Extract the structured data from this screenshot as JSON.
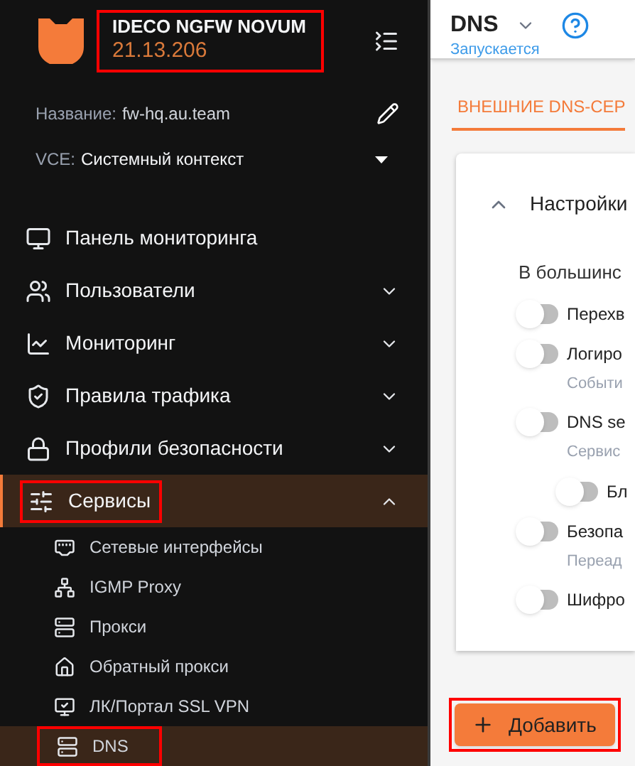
{
  "sidebar": {
    "product": "IDECO NGFW NOVUM",
    "version": "21.13.206",
    "header_highlighted": true,
    "name_label": "Название:",
    "name_value": "fw-hq.au.team",
    "vce_label": "VCE:",
    "vce_value": "Системный контекст",
    "items": [
      {
        "label": "Панель мониторинга",
        "selected": false,
        "highlighted": false
      },
      {
        "label": "Пользователи",
        "expanded": false,
        "selected": false,
        "highlighted": false
      },
      {
        "label": "Мониторинг",
        "expanded": false,
        "selected": false,
        "highlighted": false
      },
      {
        "label": "Правила трафика",
        "expanded": false,
        "selected": false,
        "highlighted": false
      },
      {
        "label": "Профили безопасности",
        "expanded": false,
        "selected": false,
        "highlighted": false
      },
      {
        "label": "Сервисы",
        "expanded": true,
        "selected": true,
        "highlighted": true,
        "children": [
          {
            "label": "Сетевые интерфейсы",
            "selected": false,
            "highlighted": false
          },
          {
            "label": "IGMP Proxy",
            "selected": false,
            "highlighted": false
          },
          {
            "label": "Прокси",
            "selected": false,
            "highlighted": false
          },
          {
            "label": "Обратный прокси",
            "selected": false,
            "highlighted": false
          },
          {
            "label": "ЛК/Портал SSL VPN",
            "selected": false,
            "highlighted": false
          },
          {
            "label": "DNS",
            "selected": true,
            "highlighted": true
          }
        ]
      }
    ]
  },
  "header": {
    "title": "DNS",
    "status": "Запускается"
  },
  "tabs": [
    {
      "label": "ВНЕШНИЕ DNS-СЕР",
      "selected": true
    }
  ],
  "settings": {
    "title": "Настройки",
    "expanded": true,
    "intro": "В большинс",
    "options": [
      {
        "label": "Перехв",
        "on": false,
        "nested": false
      },
      {
        "label": "Логиро",
        "description": "Событи",
        "on": false,
        "nested": false
      },
      {
        "label": "DNS se",
        "description": "Сервис",
        "on": false,
        "nested": false
      },
      {
        "label": "Бл",
        "on": false,
        "nested": true
      },
      {
        "label": "Безопа",
        "description": "Переад",
        "on": false,
        "nested": false
      },
      {
        "label": "Шифро",
        "on": false,
        "nested": false
      }
    ]
  },
  "add_button": {
    "label": "Добавить",
    "highlighted": true
  }
}
